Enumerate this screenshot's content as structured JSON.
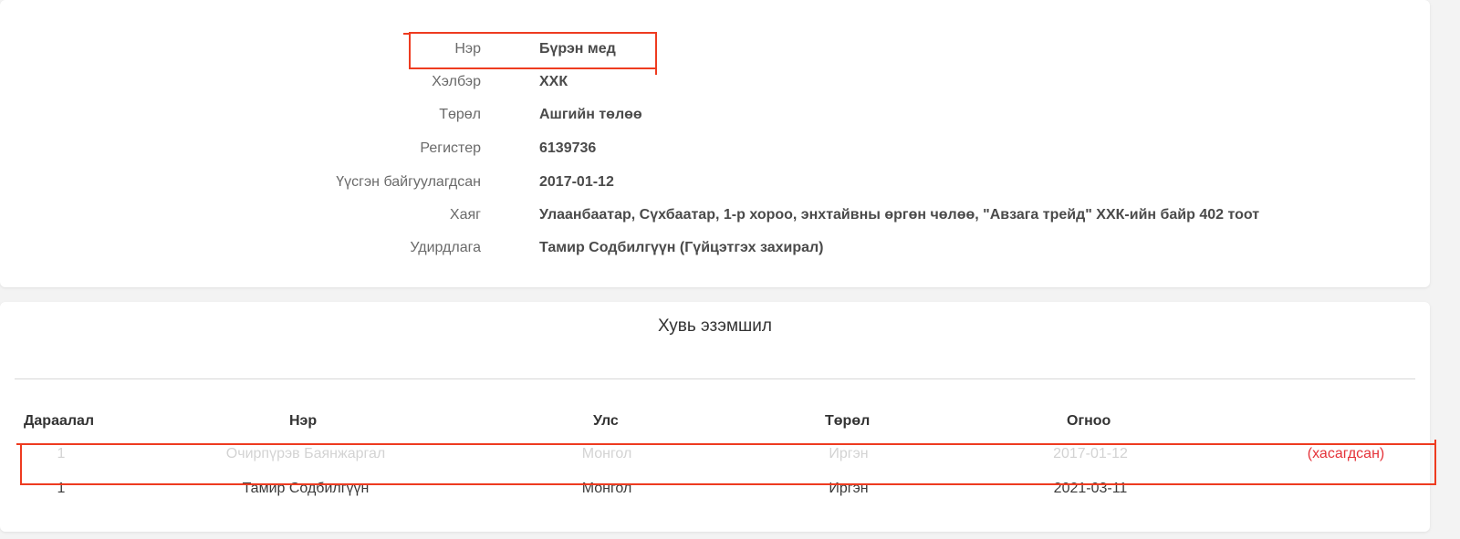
{
  "company": {
    "fields": [
      {
        "label": "Нэр",
        "value": "Бүрэн мед"
      },
      {
        "label": "Хэлбэр",
        "value": "ХХК"
      },
      {
        "label": "Төрөл",
        "value": "Ашгийн төлөө"
      },
      {
        "label": "Регистер",
        "value": "6139736"
      },
      {
        "label": "Үүсгэн байгуулагдсан",
        "value": "2017-01-12"
      },
      {
        "label": "Хаяг",
        "value": "Улаанбаатар, Сүхбаатар, 1-р хороо, энхтайвны өргөн чөлөө, \"Авзага трейд\" ХХК-ийн байр 402 тоот"
      },
      {
        "label": "Удирдлага",
        "value": "Тамир Содбилгүүн (Гүйцэтгэх захирал)"
      }
    ]
  },
  "ownership": {
    "title": "Хувь эзэмшил",
    "columns": [
      "Дараалал",
      "Нэр",
      "Улс",
      "Төрөл",
      "Огноо"
    ],
    "rows": [
      {
        "order": "1",
        "name": "Очирпүрэв Баянжаргал",
        "country": "Монгол",
        "type": "Иргэн",
        "date": "2017-01-12",
        "status": "(хасагдсан)",
        "removed": true
      },
      {
        "order": "1",
        "name": "Тамир Содбилгүүн",
        "country": "Монгол",
        "type": "Иргэн",
        "date": "2021-03-11",
        "status": "",
        "removed": false
      }
    ]
  },
  "colors": {
    "highlight": "#ee3b20",
    "removed_text": "#d3d3d3",
    "removed_tag": "#e5333a"
  }
}
